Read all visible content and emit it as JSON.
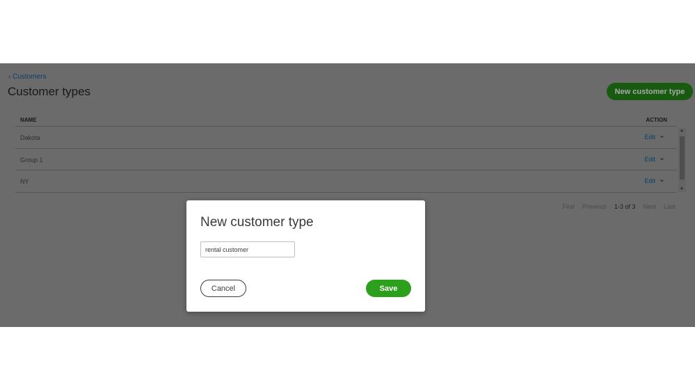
{
  "breadcrumb": {
    "back_label": "Customers"
  },
  "page": {
    "title": "Customer types",
    "new_button": "New customer type"
  },
  "table": {
    "headers": {
      "name": "NAME",
      "action": "ACTION"
    },
    "rows": [
      {
        "name": "Dakota",
        "action": "Edit"
      },
      {
        "name": "Group 1",
        "action": "Edit"
      },
      {
        "name": "NY",
        "action": "Edit"
      }
    ]
  },
  "pagination": {
    "first": "First",
    "previous": "Previous",
    "range": "1-3 of 3",
    "next": "Next",
    "last": "Last"
  },
  "modal": {
    "title": "New customer type",
    "input_value": "rental customer",
    "cancel": "Cancel",
    "save": "Save"
  }
}
